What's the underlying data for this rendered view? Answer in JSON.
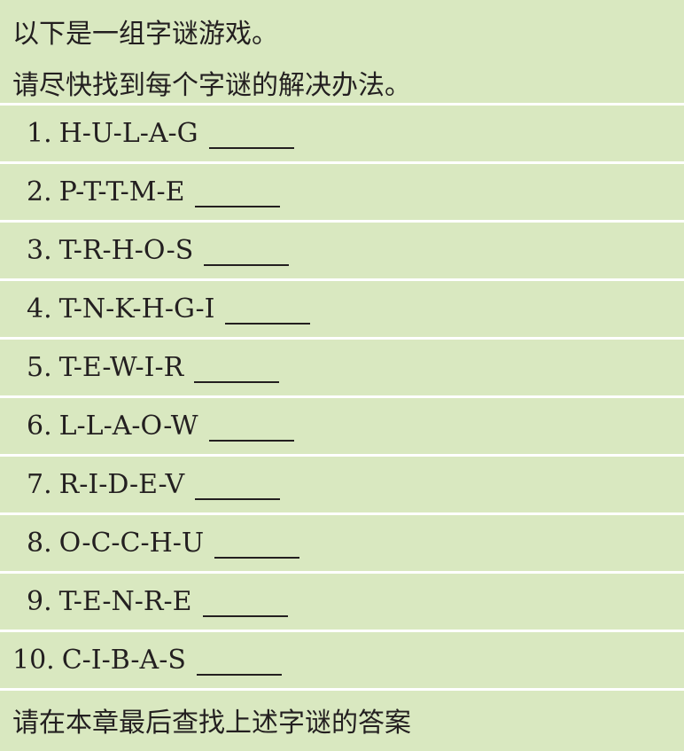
{
  "intro": {
    "line1": "以下是一组字谜游戏。",
    "line2": "请尽快找到每个字谜的解决办法。"
  },
  "puzzles": [
    {
      "number": "1.",
      "letters": "H-U-L-A-G"
    },
    {
      "number": "2.",
      "letters": "P-T-T-M-E"
    },
    {
      "number": "3.",
      "letters": "T-R-H-O-S"
    },
    {
      "number": "4.",
      "letters": "T-N-K-H-G-I"
    },
    {
      "number": "5.",
      "letters": "T-E-W-I-R"
    },
    {
      "number": "6.",
      "letters": "L-L-A-O-W"
    },
    {
      "number": "7.",
      "letters": "R-I-D-E-V"
    },
    {
      "number": "8.",
      "letters": "O-C-C-H-U"
    },
    {
      "number": "9.",
      "letters": "T-E-N-R-E"
    },
    {
      "number": "10.",
      "letters": "C-I-B-A-S"
    }
  ],
  "footer": {
    "text": "请在本章最后查找上述字谜的答案"
  },
  "colors": {
    "background": "#d9e8c0",
    "divider": "#ffffff",
    "text": "#231f20"
  }
}
